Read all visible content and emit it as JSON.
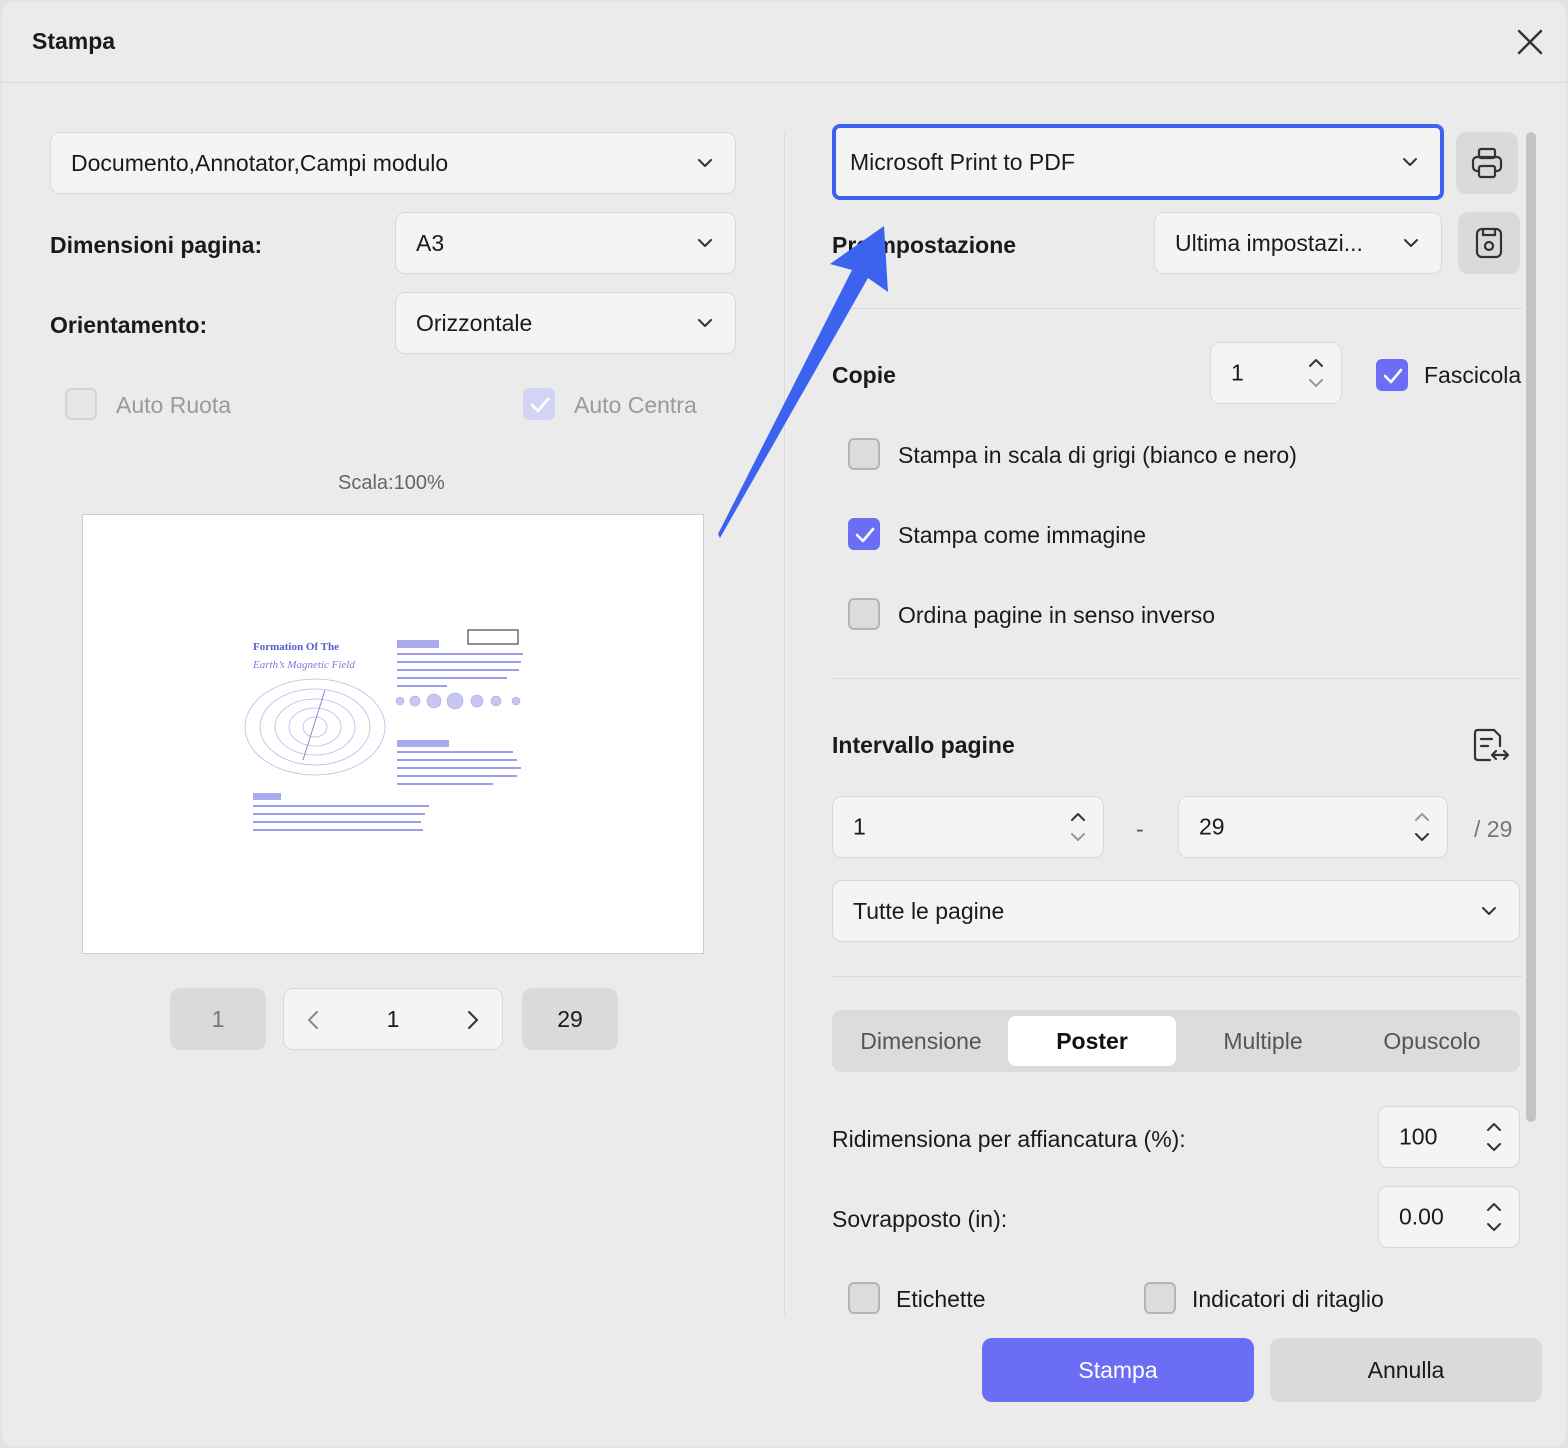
{
  "dialog": {
    "title": "Stampa"
  },
  "left": {
    "content_select": "Documento,Annotator,Campi modulo",
    "page_size_label": "Dimensioni pagina:",
    "page_size_value": "A3",
    "orientation_label": "Orientamento:",
    "orientation_value": "Orizzontale",
    "auto_rotate_label": "Auto Ruota",
    "auto_center_label": "Auto Centra",
    "scale_text": "Scala:100%",
    "preview": {
      "title_line1": "Formation Of The",
      "title_line2": "Earth’s Magnetic Field"
    },
    "pager": {
      "first": "1",
      "current": "1",
      "last": "29"
    }
  },
  "right": {
    "printer": "Microsoft Print to PDF",
    "preset_label": "Preimpostazione",
    "preset_value": "Ultima impostazi...",
    "copies_label": "Copie",
    "copies_value": "1",
    "collate_label": "Fascicola",
    "grayscale_label": "Stampa in scala di grigi (bianco e nero)",
    "as_image_label": "Stampa come immagine",
    "reverse_label": "Ordina pagine in senso inverso",
    "range_label": "Intervallo pagine",
    "range_from": "1",
    "range_dash": "-",
    "range_to": "29",
    "range_total": "/ 29",
    "range_mode": "Tutte le pagine",
    "tabs": [
      "Dimensione",
      "Poster",
      "Multiple",
      "Opuscolo"
    ],
    "tile_scale_label": "Ridimensiona per affiancatura (%):",
    "tile_scale_value": "100",
    "overlap_label": "Sovrapposto (in):",
    "overlap_value": "0.00",
    "labels_label": "Etichette",
    "crop_marks_label": "Indicatori di ritaglio"
  },
  "footer": {
    "print_button": "Stampa",
    "cancel_button": "Annulla"
  },
  "colors": {
    "accent": "#6b6ef5",
    "annotation_arrow": "#3b63f0"
  }
}
